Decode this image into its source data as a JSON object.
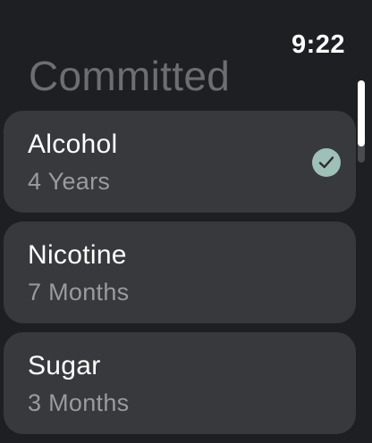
{
  "status": {
    "time": "9:22"
  },
  "page": {
    "title": "Committed"
  },
  "items": [
    {
      "title": "Alcohol",
      "duration": "4 Years",
      "selected": true
    },
    {
      "title": "Nicotine",
      "duration": "7 Months",
      "selected": false
    },
    {
      "title": "Sugar",
      "duration": "3 Months",
      "selected": false
    }
  ],
  "icons": {
    "checkmark": "checkmark-circle-icon"
  },
  "colors": {
    "background": "#1e1f22",
    "card": "#38393d",
    "accent": "#9fc0b6",
    "title": "#6d6e72"
  },
  "scroll": {
    "position": 0.0
  }
}
